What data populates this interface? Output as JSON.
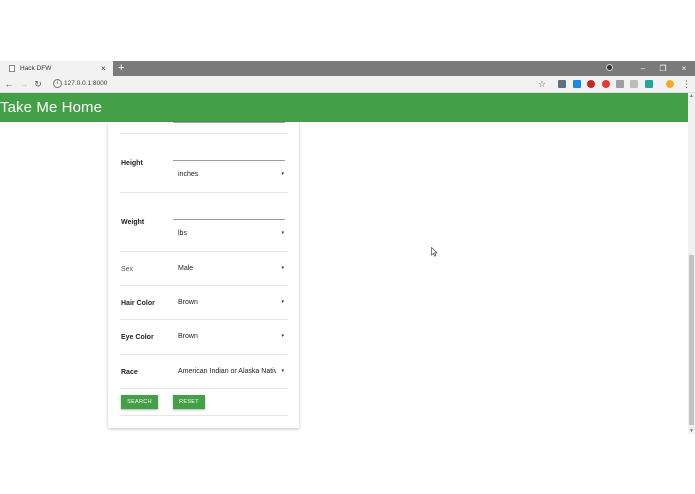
{
  "browser": {
    "tab_title": "Hack DFW",
    "tab_close": "×",
    "new_tab": "+",
    "url": "127.0.0.1:8000",
    "window_minimize": "–",
    "window_restore": "❐",
    "window_close": "×"
  },
  "app": {
    "title": "Take Me Home"
  },
  "form": {
    "height": {
      "label": "Height",
      "unit": "inches"
    },
    "weight": {
      "label": "Weight",
      "unit": "lbs"
    },
    "sex": {
      "label": "Sex",
      "value": "Male"
    },
    "hair_color": {
      "label": "Hair Color",
      "value": "Brown"
    },
    "eye_color": {
      "label": "Eye Color",
      "value": "Brown"
    },
    "race": {
      "label": "Race",
      "value": "American Indian or Alaska Native"
    },
    "search_label": "SEARCH",
    "reset_label": "RESET"
  },
  "icons": {
    "dropdown": "▾"
  }
}
